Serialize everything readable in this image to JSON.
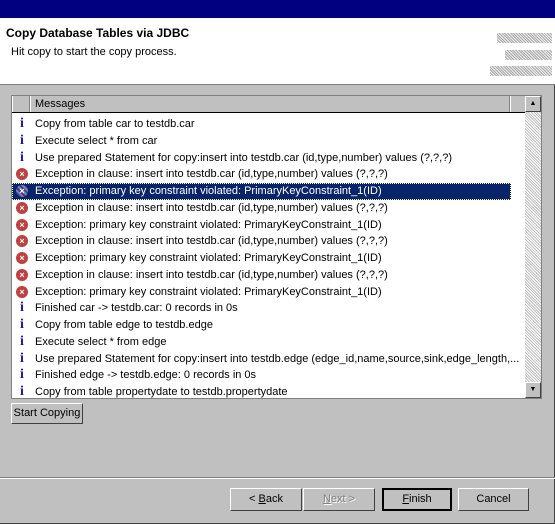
{
  "header": {
    "title": "Copy Database Tables via JDBC",
    "description": "Hit copy to start the copy process."
  },
  "table": {
    "column": "Messages",
    "rows": [
      {
        "type": "info",
        "text": "Copy from table car to testdb.car"
      },
      {
        "type": "info",
        "text": "Execute select * from car"
      },
      {
        "type": "info",
        "text": "Use prepared Statement for copy:insert into testdb.car (id,type,number) values (?,?,?)"
      },
      {
        "type": "error",
        "text": "Exception in clause: insert into testdb.car (id,type,number) values (?,?,?)"
      },
      {
        "type": "error",
        "text": "Exception: primary key constraint violated: PrimaryKeyConstraint_1(ID)",
        "selected": true
      },
      {
        "type": "error",
        "text": "Exception in clause: insert into testdb.car (id,type,number) values (?,?,?)"
      },
      {
        "type": "error",
        "text": "Exception: primary key constraint violated: PrimaryKeyConstraint_1(ID)"
      },
      {
        "type": "error",
        "text": "Exception in clause: insert into testdb.car (id,type,number) values (?,?,?)"
      },
      {
        "type": "error",
        "text": "Exception: primary key constraint violated: PrimaryKeyConstraint_1(ID)"
      },
      {
        "type": "error",
        "text": "Exception in clause: insert into testdb.car (id,type,number) values (?,?,?)"
      },
      {
        "type": "error",
        "text": "Exception: primary key constraint violated: PrimaryKeyConstraint_1(ID)"
      },
      {
        "type": "info",
        "text": "Finished car -> testdb.car: 0 records in 0s"
      },
      {
        "type": "info",
        "text": "Copy from table edge to testdb.edge"
      },
      {
        "type": "info",
        "text": "Execute select * from edge"
      },
      {
        "type": "info",
        "text": "Use prepared Statement for copy:insert into testdb.edge (edge_id,name,source,sink,edge_length,..."
      },
      {
        "type": "info",
        "text": "Finished edge -> testdb.edge: 0 records in 0s"
      },
      {
        "type": "info",
        "text": "Copy from table propertydate to testdb.propertydate"
      }
    ]
  },
  "start_button": "Start Copying",
  "buttons": {
    "back": {
      "pre": "< ",
      "key": "B",
      "post": "ack"
    },
    "next": {
      "key": "N",
      "post": "ext >"
    },
    "finish": {
      "key": "F",
      "post": "inish"
    },
    "cancel": "Cancel"
  }
}
